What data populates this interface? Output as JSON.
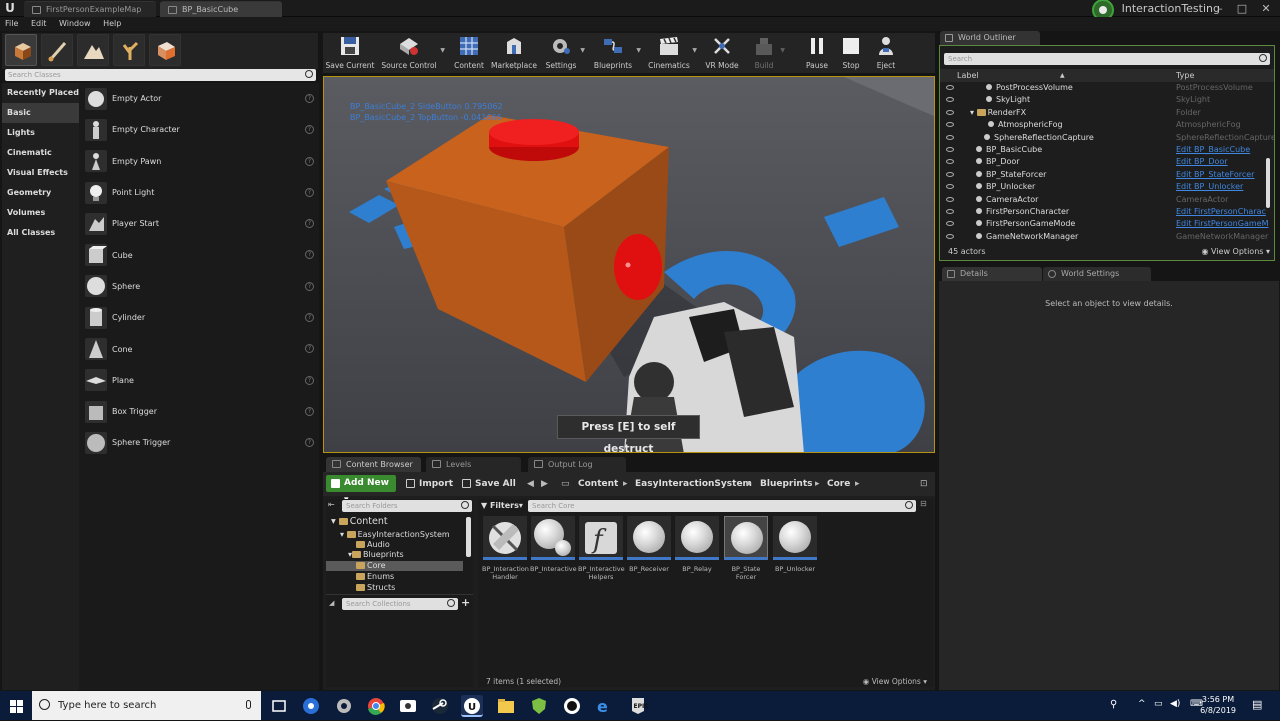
{
  "titlebar": {
    "tabs": [
      "FirstPersonExampleMap",
      "BP_BasicCube"
    ],
    "project": "InteractionTesting",
    "controls": {
      "minimize": "–",
      "maximize": "□",
      "close": "✕"
    }
  },
  "menu": [
    "File",
    "Edit",
    "Window",
    "Help"
  ],
  "modes": {
    "search_placeholder": "Search Classes",
    "categories": [
      "Recently Placed",
      "Basic",
      "Lights",
      "Cinematic",
      "Visual Effects",
      "Geometry",
      "Volumes",
      "All Classes"
    ],
    "selected_category": "Basic",
    "items": [
      "Empty Actor",
      "Empty Character",
      "Empty Pawn",
      "Point Light",
      "Player Start",
      "Cube",
      "Sphere",
      "Cylinder",
      "Cone",
      "Plane",
      "Box Trigger",
      "Sphere Trigger"
    ],
    "help_glyph": "?"
  },
  "toolbar": [
    "Save Current",
    "Source Control",
    "Content",
    "Marketplace",
    "Settings",
    "Blueprints",
    "Cinematics",
    "VR Mode",
    "Build",
    "Pause",
    "Stop",
    "Eject"
  ],
  "viewport": {
    "debug_lines": [
      "BP_BasicCube_2 SideButton 0.795062",
      "BP_BasicCube_2 TopButton -0.041666"
    ],
    "prompt": "Press [E] to self destruct"
  },
  "bottom_tabs": [
    "Content Browser",
    "Levels",
    "Output Log"
  ],
  "content_browser": {
    "add_new": "Add New",
    "import": "Import",
    "save_all": "Save All",
    "breadcrumb": [
      "Content",
      "EasyInteractionSystem",
      "Blueprints",
      "Core"
    ],
    "search_folders_placeholder": "Search Folders",
    "filters": "Filters",
    "search_core_placeholder": "Search Core",
    "search_collections_placeholder": "Search Collections",
    "tree": [
      "Content",
      "EasyInteractionSystem",
      "Audio",
      "Blueprints",
      "Core",
      "Enums",
      "Structs"
    ],
    "assets": [
      {
        "line1": "BP_Interaction",
        "line2": "Handler"
      },
      {
        "line1": "BP_Interactive",
        "line2": ""
      },
      {
        "line1": "BP_Interactive",
        "line2": "Helpers"
      },
      {
        "line1": "BP_Receiver",
        "line2": ""
      },
      {
        "line1": "BP_Relay",
        "line2": ""
      },
      {
        "line1": "BP_State",
        "line2": "Forcer"
      },
      {
        "line1": "BP_Unlocker",
        "line2": ""
      }
    ],
    "selected_asset": "BP_StateForcer",
    "status": "7 items (1 selected)",
    "view_options": "View Options"
  },
  "world_outliner": {
    "tab": "World Outliner",
    "search_placeholder": "Search",
    "col_label": "Label",
    "col_type": "Type",
    "rows": [
      {
        "label": "PostProcessVolume",
        "type": "PostProcessVolume",
        "link": false
      },
      {
        "label": "SkyLight",
        "type": "SkyLight",
        "link": false
      },
      {
        "label": "RenderFX",
        "type": "Folder",
        "link": false
      },
      {
        "label": "AtmosphericFog",
        "type": "AtmosphericFog",
        "link": false
      },
      {
        "label": "SphereReflectionCapture",
        "type": "SphereReflectionCapture",
        "link": false
      },
      {
        "label": "BP_BasicCube",
        "type": "Edit BP_BasicCube",
        "link": true
      },
      {
        "label": "BP_Door",
        "type": "Edit BP_Door",
        "link": true
      },
      {
        "label": "BP_StateForcer",
        "type": "Edit BP_StateForcer",
        "link": true
      },
      {
        "label": "BP_Unlocker",
        "type": "Edit BP_Unlocker",
        "link": true
      },
      {
        "label": "CameraActor",
        "type": "CameraActor",
        "link": false
      },
      {
        "label": "FirstPersonCharacter",
        "type": "Edit FirstPersonCharac",
        "link": true
      },
      {
        "label": "FirstPersonGameMode",
        "type": "Edit FirstPersonGameM",
        "link": true
      },
      {
        "label": "GameNetworkManager",
        "type": "GameNetworkManager",
        "link": false
      }
    ],
    "count": "45 actors",
    "view_options": "View Options"
  },
  "details": {
    "tabs": [
      "Details",
      "World Settings"
    ],
    "empty_message": "Select an object to view details."
  },
  "taskbar": {
    "search_placeholder": "Type here to search",
    "time": "3:56 PM",
    "date": "6/8/2019"
  },
  "colors": {
    "accent_green": "#3a8a2f",
    "selection_gold": "#b8940e",
    "link_blue": "#3f87e0",
    "cube_orange": "#b55a18",
    "button_red": "#e01010"
  }
}
